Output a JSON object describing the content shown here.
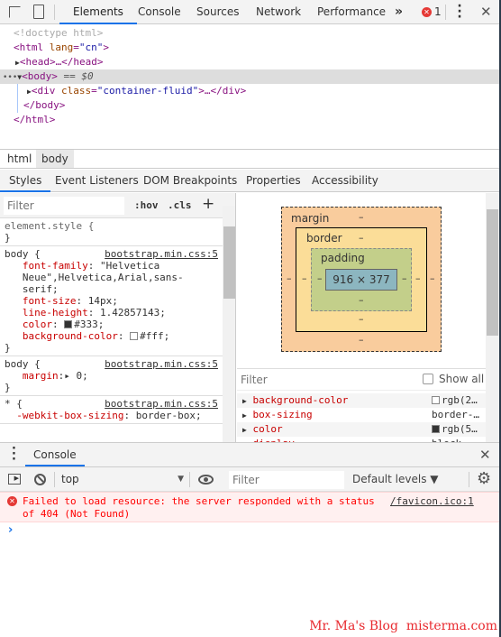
{
  "toolbar": {
    "tabs": [
      "Elements",
      "Console",
      "Sources",
      "Network",
      "Performance"
    ],
    "more": "»",
    "error_count": "1"
  },
  "dom": {
    "doctype": "<!doctype html>",
    "html_open": "<html",
    "html_attr": "lang",
    "html_val": "\"cn\"",
    "head": "<head>…</head>",
    "body": "<body>",
    "body_marker": "== $0",
    "div_open": "<div",
    "div_attr": "class",
    "div_val": "\"container-fluid\"",
    "div_close": ">…</div>",
    "body_close": "</body>",
    "html_close": "</html>"
  },
  "breadcrumbs": [
    "html",
    "body"
  ],
  "sidebar_tabs": [
    "Styles",
    "Event Listeners",
    "DOM Breakpoints",
    "Properties",
    "Accessibility"
  ],
  "styles": {
    "filter_placeholder": "Filter",
    "hov": ":hov",
    "cls": ".cls",
    "add": "+",
    "rules": [
      {
        "selector": "element.style {",
        "source": "",
        "props": []
      },
      {
        "selector": "body {",
        "source": "bootstrap.min.css:5",
        "props": [
          {
            "name": "font-family",
            "value": "\"Helvetica\n   Neue\",Helvetica,Arial,sans-\n   serif;"
          },
          {
            "name": "font-size",
            "value": "14px;"
          },
          {
            "name": "line-height",
            "value": "1.42857143;"
          },
          {
            "name": "color",
            "value": "#333;",
            "swatch": "#333333"
          },
          {
            "name": "background-color",
            "value": "#fff;",
            "swatch": "#ffffff"
          }
        ]
      },
      {
        "selector": "body {",
        "source": "bootstrap.min.css:5",
        "props": [
          {
            "name": "margin",
            "value": "▸ 0;"
          }
        ]
      },
      {
        "selector": "* {",
        "source": "bootstrap.min.css:5",
        "props": [
          {
            "name": "-webkit-box-sizing",
            "value": "border-box;"
          }
        ]
      }
    ]
  },
  "box_model": {
    "margin": "margin",
    "border": "border",
    "padding": "padding",
    "content": "916 × 377",
    "empty": "–",
    "colors": {
      "margin": "#f9cc9d",
      "border": "#fbdd98",
      "padding": "#c3cf8a",
      "content": "#8cb6c0"
    }
  },
  "computed": {
    "filter_placeholder": "Filter",
    "show_all": "Show all",
    "rows": [
      {
        "name": "background-color",
        "value": "rgb(2…",
        "swatch": "#ffffff"
      },
      {
        "name": "box-sizing",
        "value": "border-…"
      },
      {
        "name": "color",
        "value": "rgb(5…",
        "swatch": "#333333"
      },
      {
        "name": "display",
        "value": "block"
      }
    ]
  },
  "console": {
    "tab": "Console",
    "context": "top",
    "filter_placeholder": "Filter",
    "levels": "Default levels ▼",
    "error": {
      "message": "Failed to load resource: the server responded with a status\nof 404 (Not Found)",
      "source": "/favicon.ico:1"
    },
    "prompt": "›"
  },
  "watermark": "Mr. Ma's Blog  misterma.com"
}
